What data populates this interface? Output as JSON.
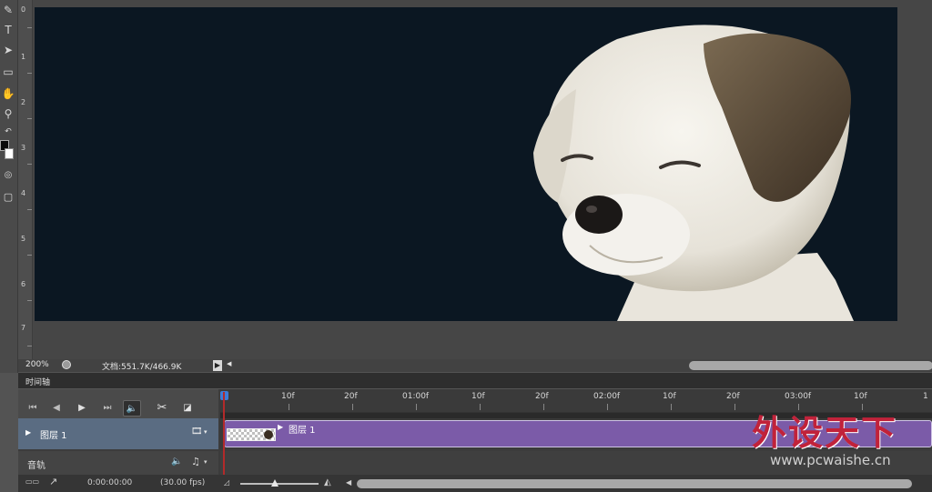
{
  "toolbar": {
    "tools": [
      {
        "icon": "brush-tool-icon",
        "glyph": "✎"
      },
      {
        "icon": "text-tool-icon",
        "glyph": "T"
      },
      {
        "icon": "path-selection-tool-icon",
        "glyph": "➤"
      },
      {
        "icon": "rectangle-tool-icon",
        "glyph": "▭"
      },
      {
        "icon": "hand-tool-icon",
        "glyph": "✋"
      },
      {
        "icon": "zoom-tool-icon",
        "glyph": "⚲"
      },
      {
        "icon": "swap-colors-icon",
        "glyph": "↶"
      },
      {
        "icon": "quick-mask-icon",
        "glyph": "◎"
      },
      {
        "icon": "screen-mode-icon",
        "glyph": "▢"
      }
    ],
    "colors": {
      "foreground": "#0a0a0a",
      "background": "#ffffff"
    }
  },
  "ruler": {
    "labels": [
      "0",
      "1",
      "2",
      "3",
      "4",
      "5",
      "6",
      "7"
    ]
  },
  "status": {
    "zoom": "200%",
    "doc_info": "文档:551.7K/466.9K"
  },
  "timeline": {
    "panel_title": "时间轴",
    "ruler_labels": [
      "10f",
      "20f",
      "01:00f",
      "10f",
      "20f",
      "02:00f",
      "10f",
      "20f",
      "03:00f",
      "10f",
      "1"
    ],
    "layer_name": "图层 1",
    "clip_label": "图层 1",
    "audio_label": "音轨",
    "timecode": "0:00:00:00",
    "fps": "(30.00 fps)"
  },
  "watermark": {
    "title": "外设天下",
    "url": "www.pcwaishe.cn"
  },
  "colors": {
    "canvas_bg": "#0b1722",
    "clip": "#7b5ba8",
    "layer_row": "#5a6c82",
    "playhead": "#b22a2a"
  }
}
